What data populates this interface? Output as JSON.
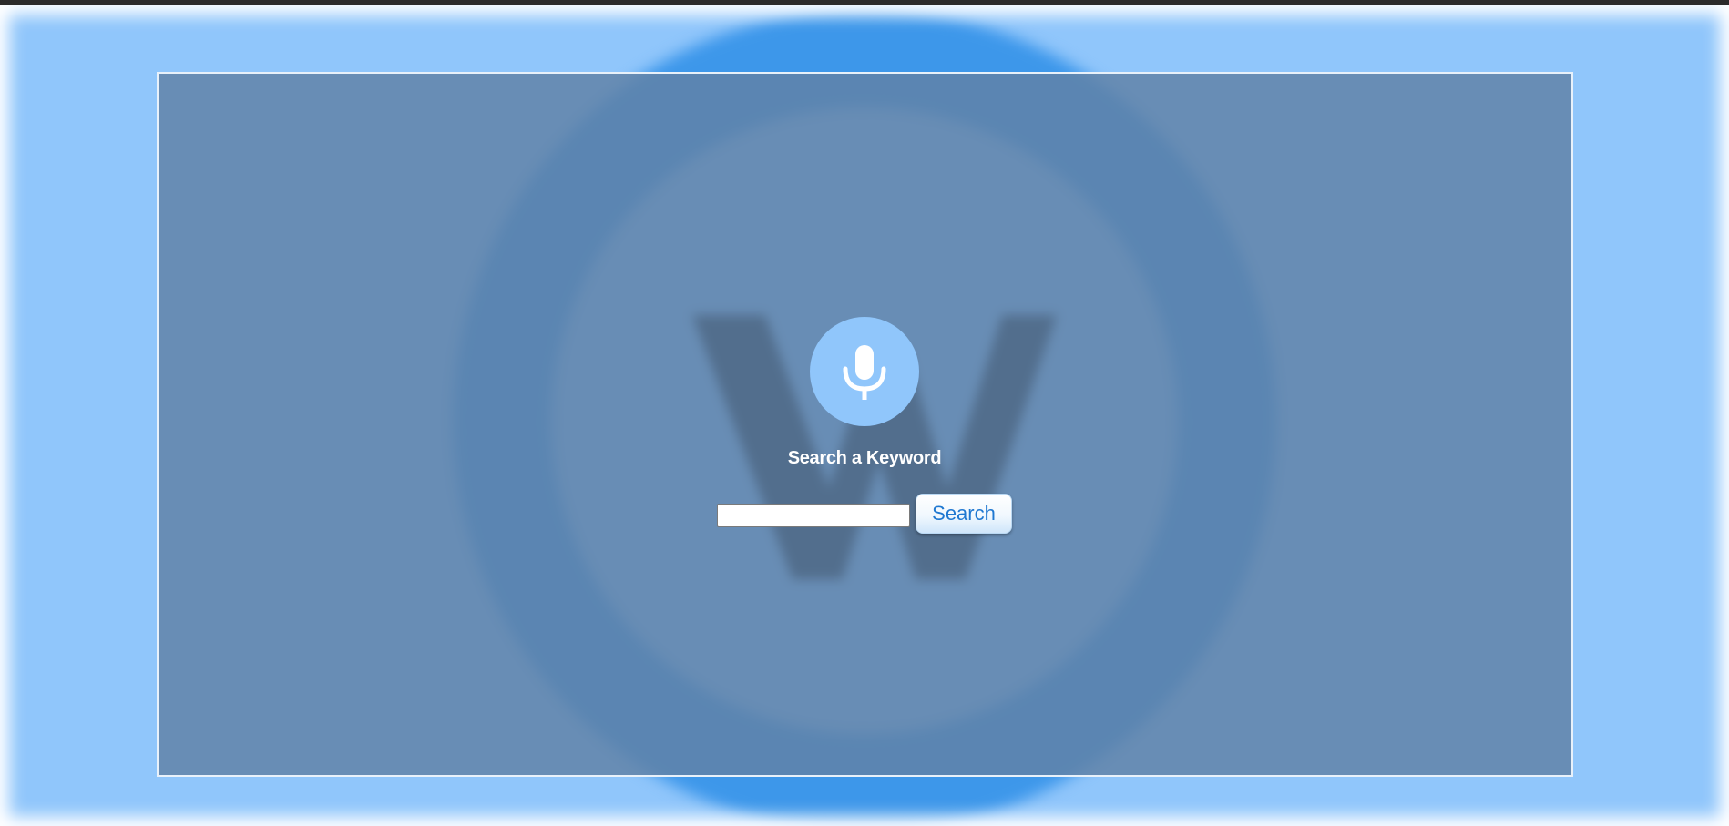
{
  "heading": "Search a Keyword",
  "search": {
    "value": "",
    "placeholder": "",
    "button_label": "Search"
  },
  "icons": {
    "mic": "microphone-icon",
    "background_logo": "w-ring-logo"
  },
  "colors": {
    "backdrop": "#90c6fb",
    "panel_overlay": "#6082a7",
    "logo_ring": "#3d97ea",
    "mic_button": "#90c6fb",
    "button_text": "#1f78d1",
    "heading_text": "#ffffff"
  }
}
